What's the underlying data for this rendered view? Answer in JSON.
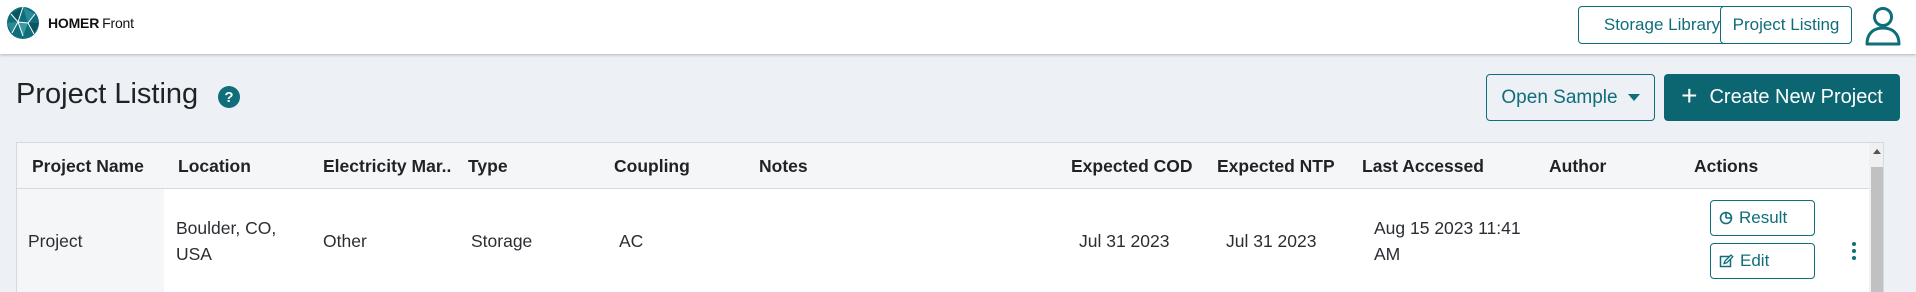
{
  "app": {
    "logo_bold": "HOMER",
    "logo_light": "Front"
  },
  "nav": {
    "storage_library": "Storage Library",
    "project_listing": "Project Listing"
  },
  "page": {
    "title": "Project Listing",
    "help": "?",
    "open_sample": "Open Sample",
    "create_new": "Create New Project"
  },
  "table": {
    "headers": {
      "name": "Project Name",
      "location": "Location",
      "market": "Electricity Mar..",
      "type": "Type",
      "coupling": "Coupling",
      "notes": "Notes",
      "cod": "Expected COD",
      "ntp": "Expected NTP",
      "accessed": "Last Accessed",
      "author": "Author",
      "actions": "Actions"
    },
    "rows": [
      {
        "name": "Project",
        "location_line1": "Boulder, CO,",
        "location_line2": "USA",
        "market": "Other",
        "type": "Storage",
        "coupling": "AC",
        "notes": "",
        "cod": "Jul 31 2023",
        "ntp": "Jul 31 2023",
        "accessed_line1": "Aug 15 2023 11:41",
        "accessed_line2": "AM",
        "author": "",
        "result_label": "Result",
        "edit_label": "Edit"
      }
    ]
  },
  "colors": {
    "accent": "#0f6e7a",
    "primary_button": "#0b6672",
    "page_background": "#edf0f4"
  }
}
